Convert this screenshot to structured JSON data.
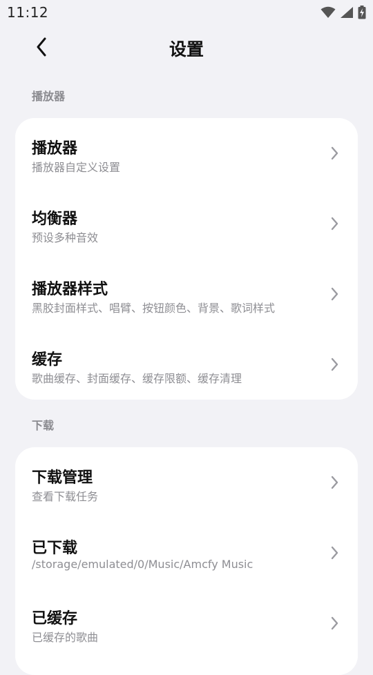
{
  "status_bar": {
    "time": "11:12",
    "icons": [
      "wifi-icon",
      "signal-icon",
      "battery-charging-icon"
    ]
  },
  "header": {
    "title": "设置",
    "back_icon": "chevron-left-icon"
  },
  "sections": [
    {
      "label": "播放器",
      "items": [
        {
          "title": "播放器",
          "subtitle": "播放器自定义设置"
        },
        {
          "title": "均衡器",
          "subtitle": "预设多种音效"
        },
        {
          "title": "播放器样式",
          "subtitle": "黑胶封面样式、唱臂、按钮颜色、背景、歌词样式"
        },
        {
          "title": "缓存",
          "subtitle": "歌曲缓存、封面缓存、缓存限额、缓存清理"
        }
      ]
    },
    {
      "label": "下载",
      "items": [
        {
          "title": "下载管理",
          "subtitle": "查看下载任务"
        },
        {
          "title": "已下载",
          "subtitle": "/storage/emulated/0/Music/Amcfy Music"
        },
        {
          "title": "已缓存",
          "subtitle": "已缓存的歌曲"
        }
      ]
    }
  ],
  "colors": {
    "background": "#f2f2f6",
    "card": "#ffffff",
    "section_label": "#8a8a8f",
    "subtitle": "#8e8e93",
    "chevron": "#9a9aa0"
  }
}
